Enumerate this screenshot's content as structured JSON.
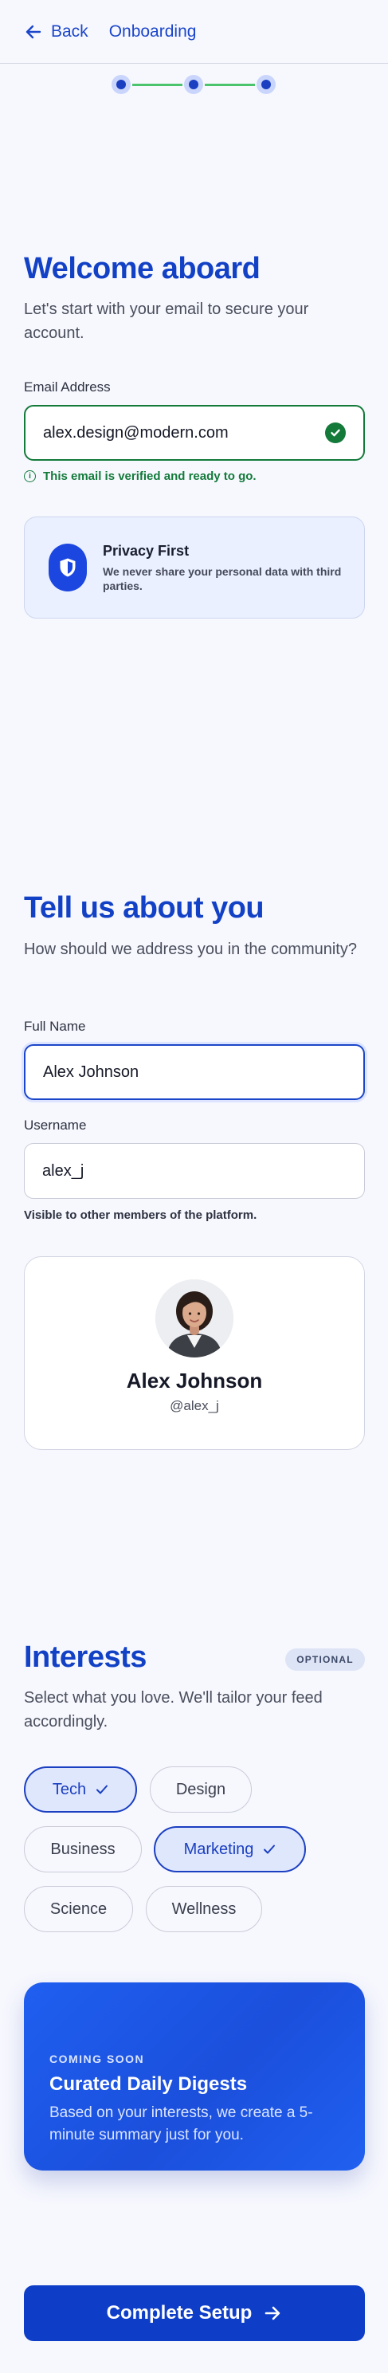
{
  "header": {
    "back_label": "Back",
    "title": "Onboarding"
  },
  "stepper": {
    "steps": 3
  },
  "welcome": {
    "title": "Welcome aboard",
    "subtitle": "Let's start with your email to secure your account.",
    "email_label": "Email Address",
    "email_value": "alex.design@modern.com",
    "email_hint": "This email is verified and ready to go.",
    "privacy_title": "Privacy First",
    "privacy_text": "We never share your personal data with third parties."
  },
  "about": {
    "title": "Tell us about you",
    "subtitle": "How should we address you in the community?",
    "fullname_label": "Full Name",
    "fullname_value": "Alex Johnson",
    "username_label": "Username",
    "username_value": "alex_j",
    "username_hint": "Visible to other members of the platform.",
    "profile_name": "Alex Johnson",
    "profile_handle": "@alex_j"
  },
  "interests": {
    "title": "Interests",
    "badge": "OPTIONAL",
    "subtitle": "Select what you love. We'll tailor your feed accordingly.",
    "chips": [
      {
        "label": "Tech",
        "selected": true
      },
      {
        "label": "Design",
        "selected": false
      },
      {
        "label": "Business",
        "selected": false
      },
      {
        "label": "Marketing",
        "selected": true
      },
      {
        "label": "Science",
        "selected": false
      },
      {
        "label": "Wellness",
        "selected": false
      }
    ]
  },
  "coming_soon": {
    "kicker": "COMING SOON",
    "title": "Curated Daily Digests",
    "text": "Based on your interests, we create a 5-minute summary just for you."
  },
  "cta": {
    "label": "Complete Setup"
  },
  "colors": {
    "accent": "#1241c6",
    "success": "#137a3a",
    "background": "#f7f8fe"
  }
}
